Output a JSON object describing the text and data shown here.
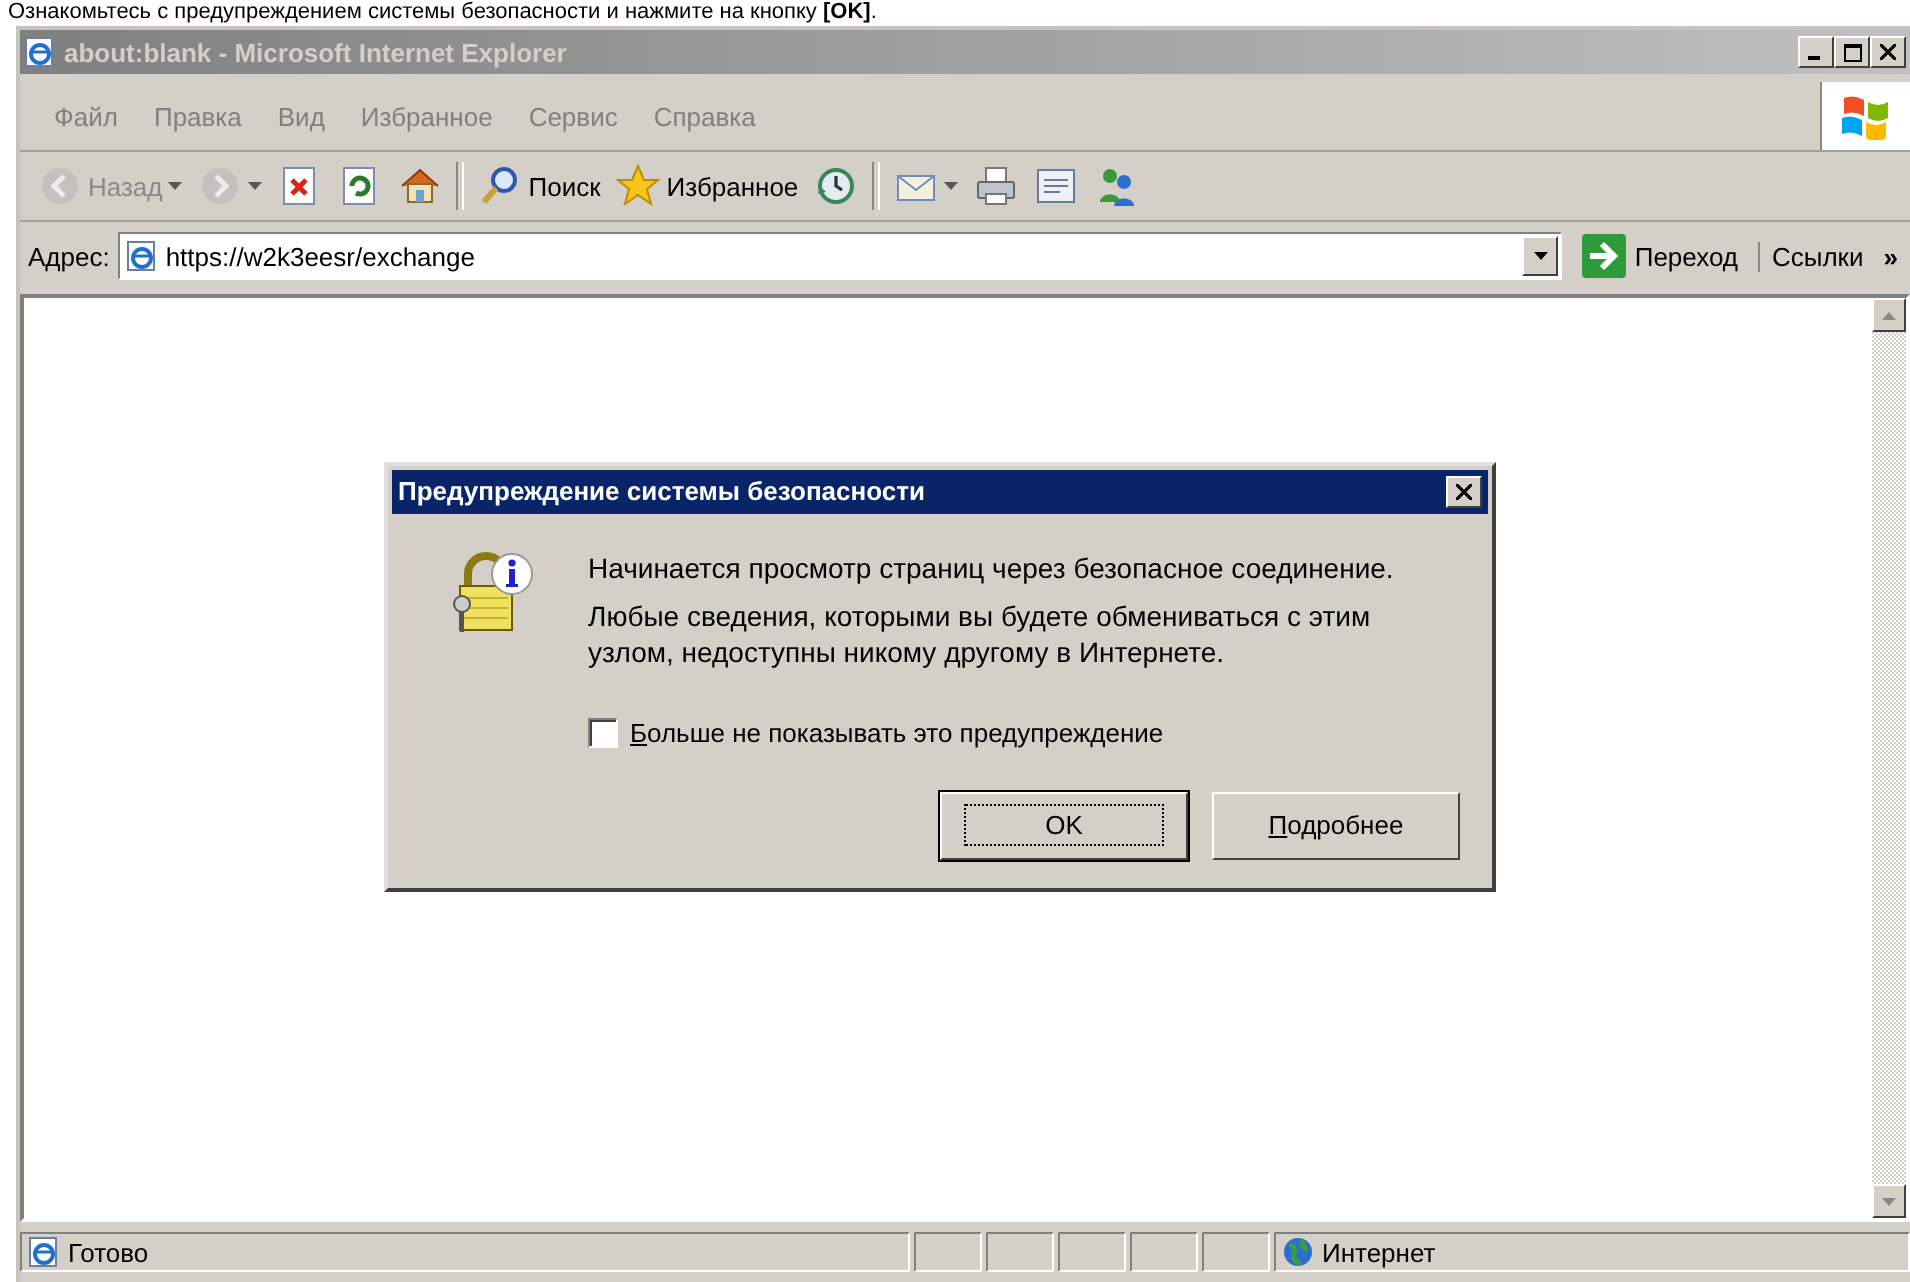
{
  "caption": "Ознакомьтесь с предупреждением системы безопасности и нажмите на кнопку **[OK]**.",
  "window": {
    "title": "about:blank - Microsoft Internet Explorer",
    "active": false
  },
  "menu": [
    "Файл",
    "Правка",
    "Вид",
    "Избранное",
    "Сервис",
    "Справка"
  ],
  "toolbar": [
    {
      "kind": "back",
      "label": "Назад",
      "disabled": true,
      "dropdown": true
    },
    {
      "kind": "forward",
      "disabled": true,
      "dropdown": true
    },
    {
      "kind": "stop",
      "disabled": false,
      "dropdown": false
    },
    {
      "kind": "refresh",
      "disabled": false,
      "dropdown": false
    },
    {
      "kind": "home",
      "disabled": false,
      "dropdown": false
    },
    {
      "kind": "separator"
    },
    {
      "kind": "search",
      "label": "Поиск",
      "disabled": false,
      "dropdown": false
    },
    {
      "kind": "favorites",
      "label": "Избранное",
      "disabled": false,
      "dropdown": false
    },
    {
      "kind": "history",
      "disabled": false,
      "dropdown": false
    },
    {
      "kind": "separator"
    },
    {
      "kind": "mail",
      "disabled": false,
      "dropdown": true
    },
    {
      "kind": "print",
      "disabled": false,
      "dropdown": false
    },
    {
      "kind": "edit",
      "disabled": false,
      "dropdown": false
    },
    {
      "kind": "messenger",
      "disabled": false,
      "dropdown": false
    }
  ],
  "address": {
    "label": "Адрес:",
    "value": "https://w2k3eesr/exchange",
    "go": "Переход",
    "links": "Ссылки",
    "more": "»"
  },
  "dialog": {
    "title": "Предупреждение системы безопасности",
    "paragraphs": [
      "Начинается просмотр страниц через безопасное соединение.",
      "Любые сведения, которыми вы будете обмениваться с этим узлом, недоступны никому другому в Интернете."
    ],
    "checkbox": {
      "label": "Больше не показывать это предупреждение",
      "checked": false,
      "underline_first": true
    },
    "buttons": [
      {
        "label": "OK",
        "default": true,
        "underline_first": false
      },
      {
        "label": "Подробнее",
        "default": false,
        "underline_first": true
      }
    ]
  },
  "status": {
    "text": "Готово",
    "zone": "Интернет"
  }
}
